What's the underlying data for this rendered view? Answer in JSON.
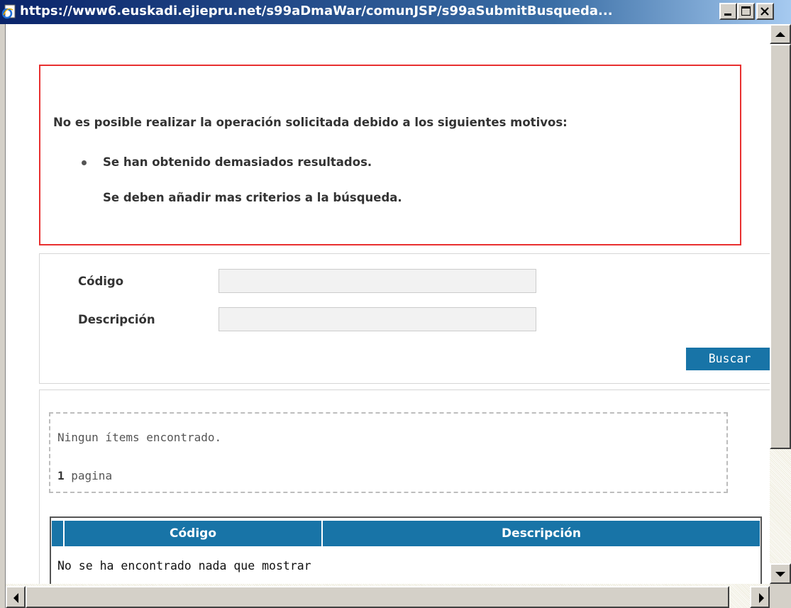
{
  "window": {
    "title": "https://www6.euskadi.ejiepru.net/s99aDmaWar/comunJSP/s99aSubmitBusqueda...",
    "title_icon": "ie-page-icon",
    "controls": [
      "minimize",
      "maximize",
      "close"
    ]
  },
  "error": {
    "title": "No es posible realizar la operación solicitada debido a los siguientes motivos:",
    "message": "Se han obtenido demasiados resultados.",
    "hint": "Se deben añadir mas criterios a la búsqueda.",
    "border_color": "#e83030"
  },
  "form": {
    "codigo_label": "Código",
    "codigo_value": "",
    "descripcion_label": "Descripción",
    "descripcion_value": "",
    "search_label": "Buscar"
  },
  "results": {
    "status": "Ningun ítems encontrado.",
    "page_count": "1",
    "page_label": " pagina",
    "columns": [
      "Código",
      "Descripción"
    ],
    "empty_message": "No se ha encontrado nada que mostrar"
  },
  "colors": {
    "accent": "#1874a7",
    "titlebar": "#0a246a"
  }
}
